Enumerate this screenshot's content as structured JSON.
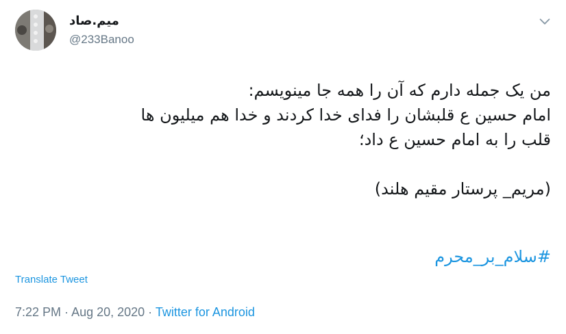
{
  "author": {
    "display_name": "میم.صاد",
    "handle": "@233Banoo"
  },
  "tweet": {
    "lines": [
      "من یک جمله دارم که آن را همه جا مینویسم:",
      "امام حسین ع  قلبشان را فدای خدا کردند و خدا هم میلیون ها",
      "قلب را به امام حسین ع داد؛"
    ],
    "signature": "(مریم_ پرستار مقیم هلند)",
    "hashtag": "#سلام_بر_محرم"
  },
  "translate_label": "Translate Tweet",
  "meta": {
    "time": "7:22 PM",
    "separator1": " · ",
    "date": "Aug 20, 2020",
    "separator2": " · ",
    "source": "Twitter for Android"
  },
  "colors": {
    "link": "#1b95e0",
    "secondary_text": "#657786",
    "primary_text": "#14171a"
  },
  "icons": {
    "menu": "chevron-down-icon"
  }
}
